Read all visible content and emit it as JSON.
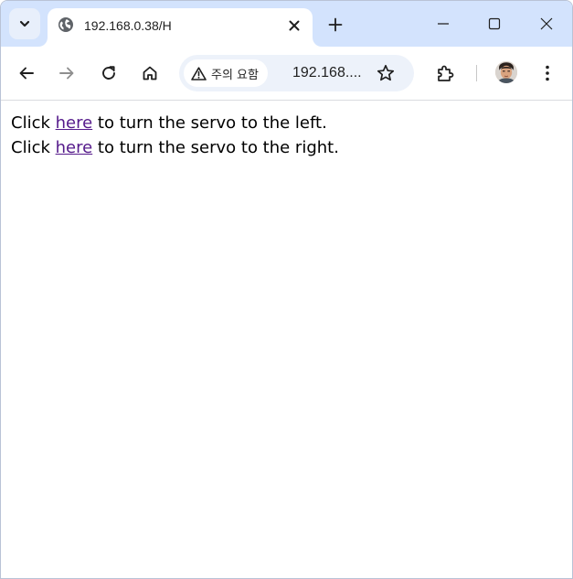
{
  "browser": {
    "tab": {
      "title": "192.168.0.38/H",
      "favicon": "globe-icon"
    },
    "toolbar": {
      "security_label": "주의 요함",
      "url": "192.168...."
    },
    "icons": {
      "tab_search": "chevron-down-icon",
      "tab_close": "close-icon",
      "new_tab": "plus-icon",
      "minimize": "minimize-icon",
      "maximize": "maximize-icon",
      "close_window": "close-icon",
      "back": "arrow-left-icon",
      "forward": "arrow-right-icon",
      "reload": "reload-icon",
      "home": "home-icon",
      "warning": "warning-icon",
      "bookmark": "star-icon",
      "extensions": "puzzle-icon",
      "profile": "avatar",
      "menu": "kebab-menu-icon"
    }
  },
  "page": {
    "lines": [
      {
        "prefix": "Click ",
        "link": "here",
        "suffix": " to turn the servo to the left."
      },
      {
        "prefix": "Click ",
        "link": "here",
        "suffix": " to turn the servo to the right."
      }
    ]
  },
  "colors": {
    "tabstrip_bg": "#d3e3fd",
    "omnibox_bg": "#edf2fa",
    "visited_link": "#551a8b"
  }
}
